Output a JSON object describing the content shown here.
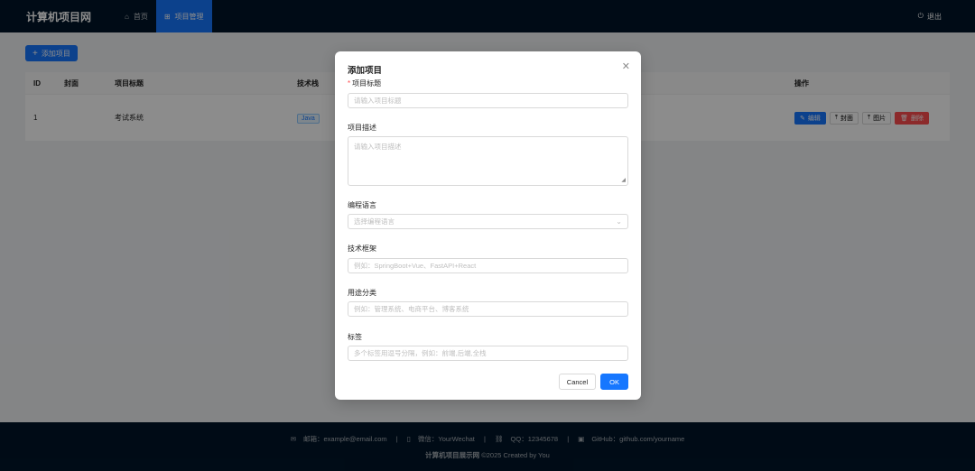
{
  "header": {
    "logo": "计算机项目网",
    "nav": [
      {
        "icon": "home-icon",
        "label": "首页"
      },
      {
        "icon": "grid-icon",
        "label": "项目管理"
      }
    ],
    "logout_label": "退出"
  },
  "toolbar": {
    "add_label": "添加项目"
  },
  "table": {
    "columns": {
      "id": "ID",
      "cover": "封面",
      "title": "项目标题",
      "tech": "技术栈",
      "ops": "操作"
    },
    "rows": [
      {
        "id": "1",
        "cover": "",
        "title": "考试系统",
        "tech": "Java"
      }
    ],
    "actions": {
      "edit": "编辑",
      "cover": "封面",
      "image": "图片",
      "delete": "删除"
    }
  },
  "modal": {
    "title": "添加项目",
    "fields": {
      "title": {
        "label": "项目标题",
        "placeholder": "请输入项目标题",
        "required": true
      },
      "desc": {
        "label": "项目描述",
        "placeholder": "请输入项目描述"
      },
      "lang": {
        "label": "编程语言",
        "placeholder": "选择编程语言"
      },
      "framework": {
        "label": "技术框架",
        "placeholder": "例如：SpringBoot+Vue、FastAPI+React"
      },
      "category": {
        "label": "用途分类",
        "placeholder": "例如：管理系统、电商平台、博客系统"
      },
      "tags": {
        "label": "标签",
        "placeholder": "多个标签用逗号分隔，例如：前端,后端,全栈"
      }
    },
    "cancel_label": "Cancel",
    "ok_label": "OK"
  },
  "footer": {
    "email": "邮箱：example@email.com",
    "wechat": "微信：YourWechat",
    "qq": "QQ：12345678",
    "github": "GitHub：github.com/yourname",
    "separator": "|",
    "copyright_bold": "计算机项目展示网",
    "copyright_rest": " ©2025 Created by You"
  },
  "colors": {
    "primary": "#1677ff",
    "danger": "#ff4d4f",
    "header_bg": "#001529"
  }
}
